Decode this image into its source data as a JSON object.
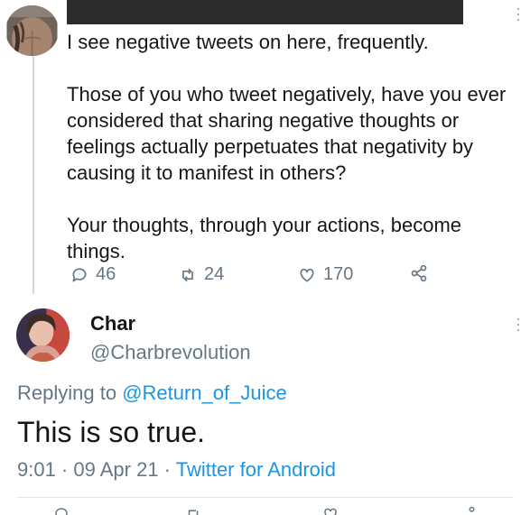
{
  "colors": {
    "link": "#1b95e0",
    "muted": "#657786",
    "text": "#14171a",
    "divider": "#e1e8ed"
  },
  "parent_tweet": {
    "paragraphs": [
      "I see negative tweets on here, frequently.",
      "Those of you who tweet negatively, have you ever considered that sharing negative thoughts or feelings actually perpetuates that negativity by causing it to manifest in others?",
      "Your thoughts, through your actions, become things."
    ],
    "stats": {
      "replies": "46",
      "retweets": "24",
      "likes": "170"
    },
    "icons": [
      "reply-icon",
      "retweet-icon",
      "like-icon",
      "share-icon"
    ]
  },
  "reply_tweet": {
    "display_name": "Char",
    "handle": "@Charbrevolution",
    "replying_prefix": "Replying to ",
    "replying_to": "@Return_of_Juice",
    "text": "This is so true.",
    "time": "9:01 · 09 Apr 21 · ",
    "source": "Twitter for Android"
  }
}
